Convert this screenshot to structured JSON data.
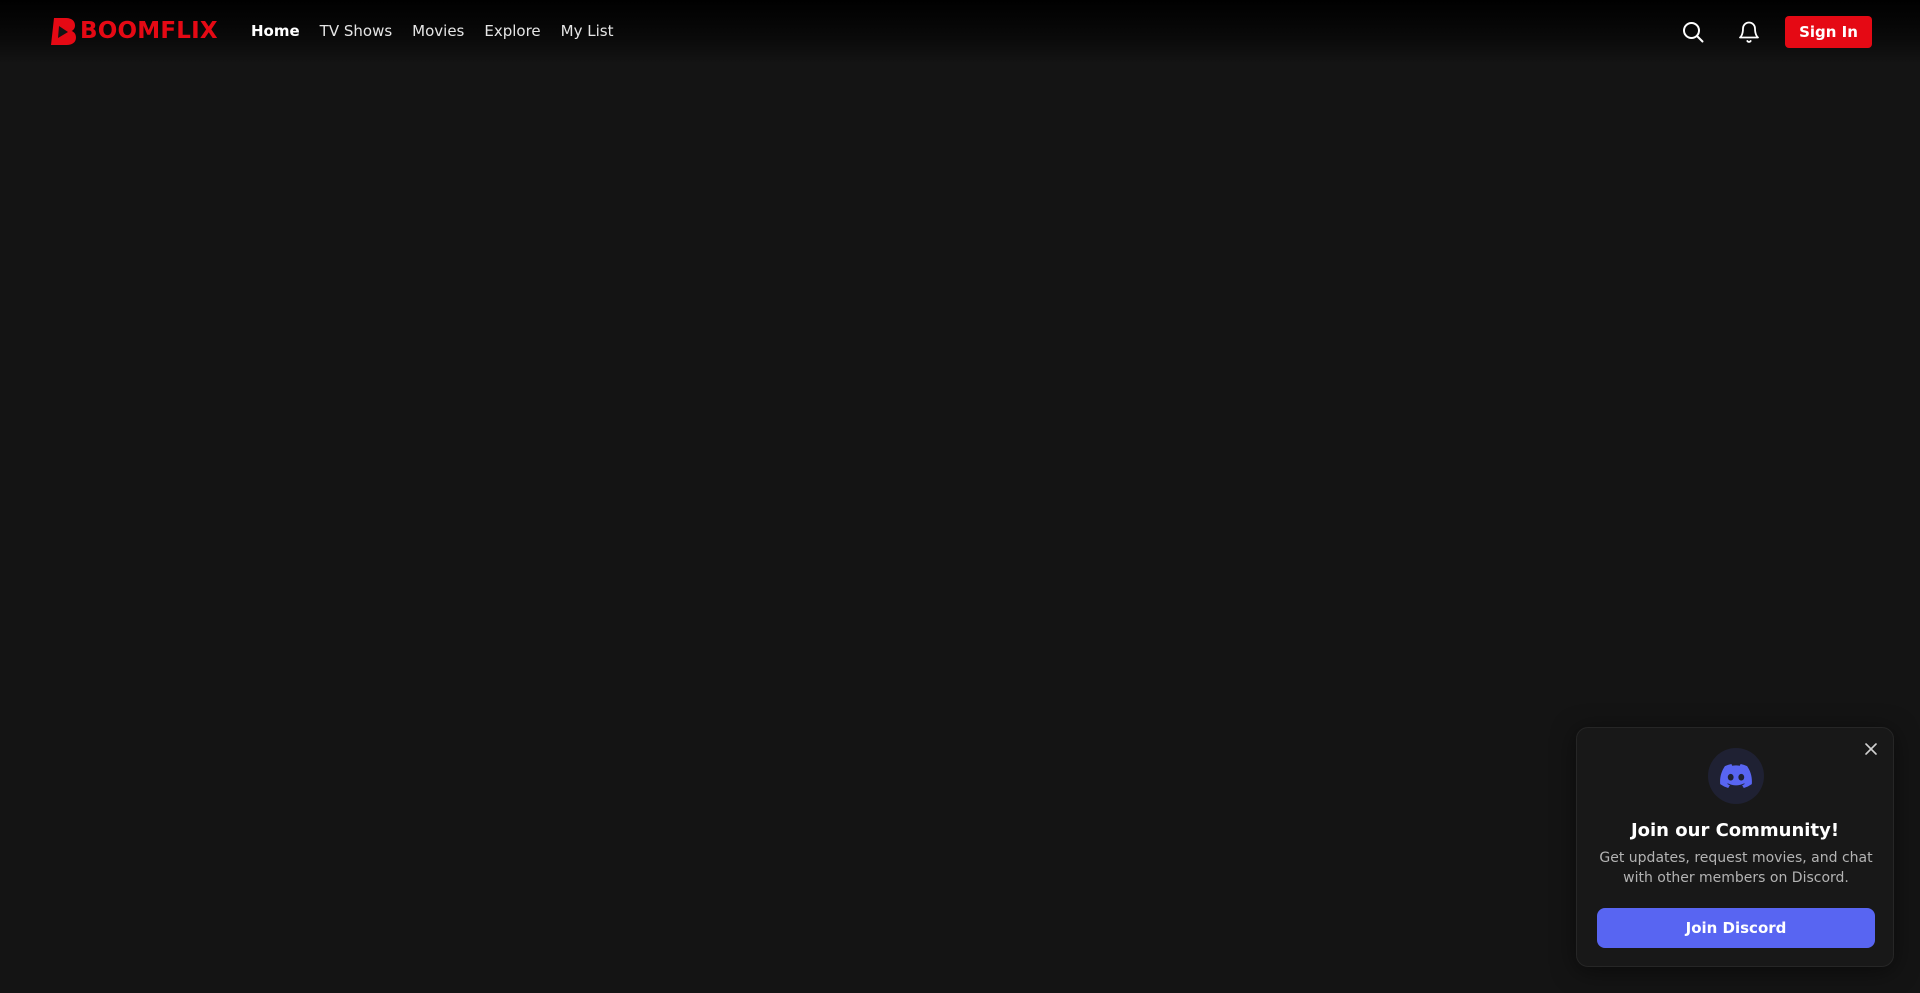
{
  "brand": {
    "name": "BOOMFLIX",
    "color": "#e50914",
    "logo_icon": "boomflix-b-play-icon"
  },
  "nav": {
    "items": [
      {
        "label": "Home",
        "active": true
      },
      {
        "label": "TV Shows",
        "active": false
      },
      {
        "label": "Movies",
        "active": false
      },
      {
        "label": "Explore",
        "active": false
      },
      {
        "label": "My List",
        "active": false
      }
    ]
  },
  "header_actions": {
    "search_icon": "search-icon",
    "notifications_icon": "bell-icon",
    "sign_in_label": "Sign In"
  },
  "discord_popup": {
    "icon": "discord-icon",
    "title": "Join our Community!",
    "description": "Get updates, request movies, and chat with other members on Discord.",
    "button_label": "Join Discord",
    "button_color": "#5865f2",
    "close_icon": "close-icon"
  },
  "colors": {
    "background": "#141414",
    "accent": "#e50914",
    "discord": "#5865f2"
  }
}
